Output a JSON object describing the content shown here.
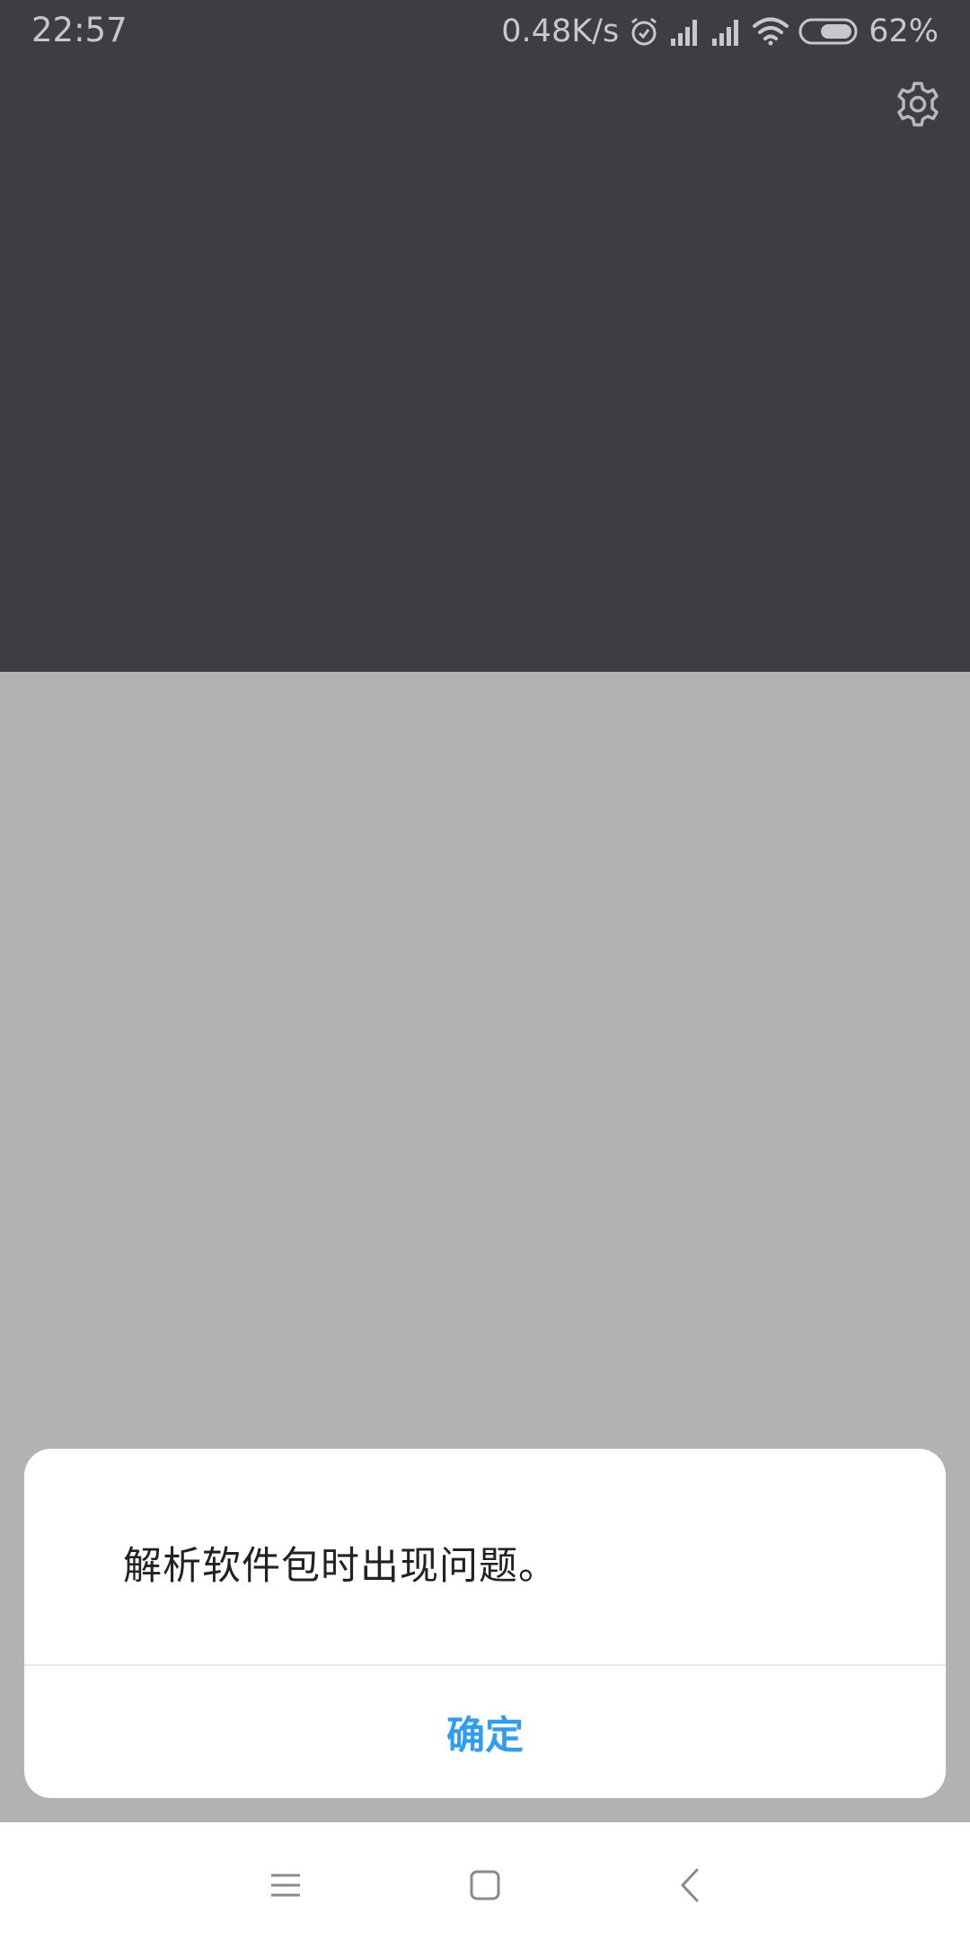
{
  "status_bar": {
    "time": "22:57",
    "net_speed": "0.48K/s",
    "battery": "62%",
    "icons": [
      "alarm-icon",
      "signal-icon",
      "signal-icon",
      "wifi-icon",
      "battery-icon"
    ]
  },
  "toolbar": {
    "settings_icon": "gear-icon"
  },
  "dialog": {
    "message": "解析软件包时出现问题。",
    "ok_label": "确定",
    "accent_color": "#2f9df0"
  },
  "nav_bar": {
    "icons": [
      "menu-icon",
      "home-icon",
      "back-icon"
    ]
  },
  "colors": {
    "top_background": "#3d3e43",
    "scrim": "#b2b2b2"
  }
}
